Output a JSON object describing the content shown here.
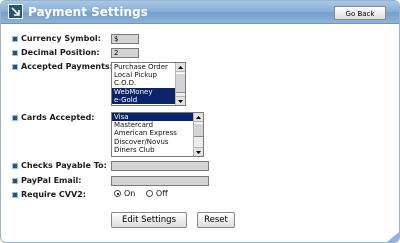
{
  "header": {
    "title": "Payment Settings",
    "go_back_label": "Go Back"
  },
  "fields": {
    "currency_symbol": {
      "label": "Currency Symbol:",
      "value": "$"
    },
    "decimal_position": {
      "label": "Decimal Position:",
      "value": "2"
    },
    "accepted_payments": {
      "label": "Accepted Payments:",
      "options": [
        {
          "text": "Purchase Order",
          "selected": false
        },
        {
          "text": "Local Pickup",
          "selected": false
        },
        {
          "text": "C.O.D.",
          "selected": false
        },
        {
          "text": "WebMoney",
          "selected": true
        },
        {
          "text": "e-Gold",
          "selected": true
        }
      ]
    },
    "cards_accepted": {
      "label": "Cards Accepted:",
      "options": [
        {
          "text": "Visa",
          "selected": true
        },
        {
          "text": "Mastercard",
          "selected": false
        },
        {
          "text": "American Express",
          "selected": false
        },
        {
          "text": "Discover/Novus",
          "selected": false
        },
        {
          "text": "Diners Club",
          "selected": false
        }
      ]
    },
    "checks_payable_to": {
      "label": "Checks Payable To:",
      "value": ""
    },
    "paypal_email": {
      "label": "PayPal Email:",
      "value": ""
    },
    "require_cvv2": {
      "label": "Require CVV2:",
      "on_label": "On",
      "off_label": "Off",
      "selected": "On"
    }
  },
  "actions": {
    "edit_label": "Edit Settings",
    "reset_label": "Reset"
  },
  "colors": {
    "header": "#86aed6",
    "selection": "#0a246a",
    "bullet": "#26527f"
  }
}
